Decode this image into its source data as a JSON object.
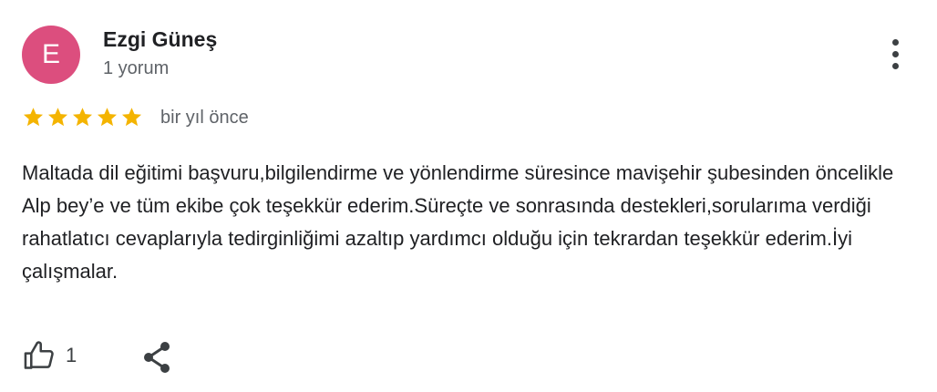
{
  "review": {
    "avatar_letter": "E",
    "avatar_color": "#dc4e7e",
    "author_name": "Ezgi Güneş",
    "author_review_count": "1 yorum",
    "rating": 5,
    "rating_max": 5,
    "star_color": "#f4b400",
    "time_ago": "bir yıl önce",
    "text": "Maltada dil eğitimi başvuru,bilgilendirme ve yönlendirme süresince mavişehir şubesinden öncelikle Alp bey’e ve tüm ekibe çok teşekkür ederim.Süreçte ve sonrasında destekleri,sorularıma verdiği rahatlatıcı cevaplarıyla tedirginliğimi azaltıp yardımcı olduğu için tekrardan teşekkür ederim.İyi çalışmalar.",
    "like_count": "1"
  },
  "icons": {
    "more": "more-vert-icon",
    "like": "thumb-up-icon",
    "share": "share-icon",
    "star": "star-icon"
  }
}
